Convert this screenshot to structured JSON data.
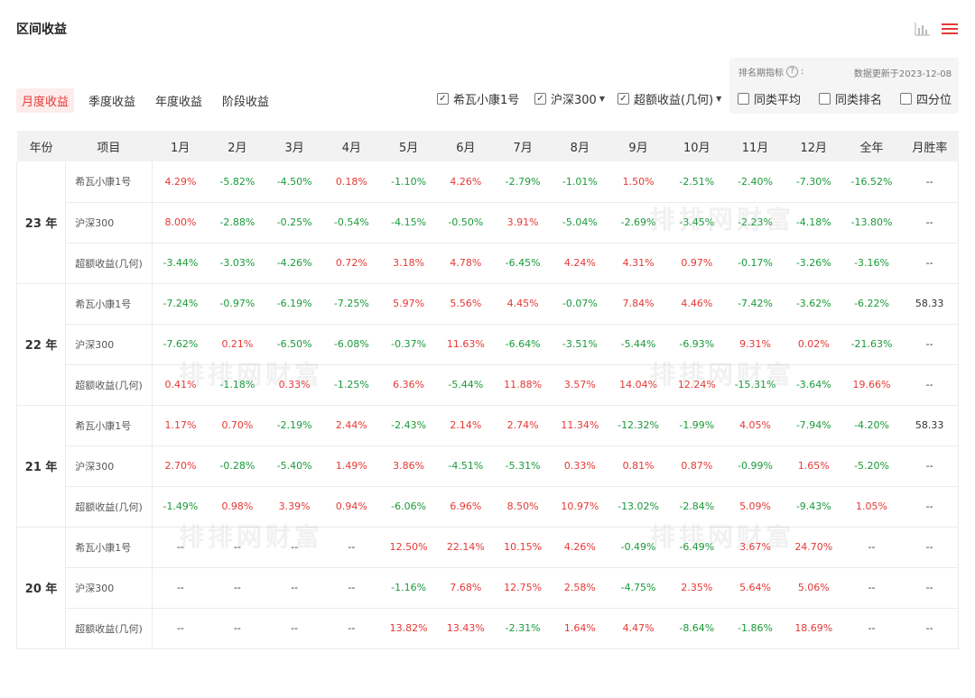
{
  "header": {
    "title": "区间收益"
  },
  "icons": {
    "chart": "bar-chart-icon",
    "menu": "menu-icon"
  },
  "tabs": [
    "月度收益",
    "季度收益",
    "年度收益",
    "阶段收益"
  ],
  "series_options": {
    "fund": "希瓦小康1号",
    "index": "沪深300",
    "excess": "超额收益(几何)"
  },
  "rank_options": {
    "label": "排名期指标",
    "updated": "数据更新于2023-12-08",
    "similar_avg": "同类平均",
    "similar_rank": "同类排名",
    "quartile": "四分位"
  },
  "watermark": "排排网财富",
  "table": {
    "headers": [
      "年份",
      "项目",
      "1月",
      "2月",
      "3月",
      "4月",
      "5月",
      "6月",
      "7月",
      "8月",
      "9月",
      "10月",
      "11月",
      "12月",
      "全年",
      "月胜率"
    ],
    "groups": [
      {
        "year": "23 年",
        "rows": [
          {
            "item": "希瓦小康1号",
            "values": [
              "4.29%",
              "-5.82%",
              "-4.50%",
              "0.18%",
              "-1.10%",
              "4.26%",
              "-2.79%",
              "-1.01%",
              "1.50%",
              "-2.51%",
              "-2.40%",
              "-7.30%",
              "-16.52%",
              "--"
            ]
          },
          {
            "item": "沪深300",
            "values": [
              "8.00%",
              "-2.88%",
              "-0.25%",
              "-0.54%",
              "-4.15%",
              "-0.50%",
              "3.91%",
              "-5.04%",
              "-2.69%",
              "-3.45%",
              "-2.23%",
              "-4.18%",
              "-13.80%",
              "--"
            ]
          },
          {
            "item": "超额收益(几何)",
            "values": [
              "-3.44%",
              "-3.03%",
              "-4.26%",
              "0.72%",
              "3.18%",
              "4.78%",
              "-6.45%",
              "4.24%",
              "4.31%",
              "0.97%",
              "-0.17%",
              "-3.26%",
              "-3.16%",
              "--"
            ]
          }
        ]
      },
      {
        "year": "22 年",
        "rows": [
          {
            "item": "希瓦小康1号",
            "values": [
              "-7.24%",
              "-0.97%",
              "-6.19%",
              "-7.25%",
              "5.97%",
              "5.56%",
              "4.45%",
              "-0.07%",
              "7.84%",
              "4.46%",
              "-7.42%",
              "-3.62%",
              "-6.22%",
              "58.33"
            ]
          },
          {
            "item": "沪深300",
            "values": [
              "-7.62%",
              "0.21%",
              "-6.50%",
              "-6.08%",
              "-0.37%",
              "11.63%",
              "-6.64%",
              "-3.51%",
              "-5.44%",
              "-6.93%",
              "9.31%",
              "0.02%",
              "-21.63%",
              "--"
            ]
          },
          {
            "item": "超额收益(几何)",
            "values": [
              "0.41%",
              "-1.18%",
              "0.33%",
              "-1.25%",
              "6.36%",
              "-5.44%",
              "11.88%",
              "3.57%",
              "14.04%",
              "12.24%",
              "-15.31%",
              "-3.64%",
              "19.66%",
              "--"
            ]
          }
        ]
      },
      {
        "year": "21 年",
        "rows": [
          {
            "item": "希瓦小康1号",
            "values": [
              "1.17%",
              "0.70%",
              "-2.19%",
              "2.44%",
              "-2.43%",
              "2.14%",
              "2.74%",
              "11.34%",
              "-12.32%",
              "-1.99%",
              "4.05%",
              "-7.94%",
              "-4.20%",
              "58.33"
            ]
          },
          {
            "item": "沪深300",
            "values": [
              "2.70%",
              "-0.28%",
              "-5.40%",
              "1.49%",
              "3.86%",
              "-4.51%",
              "-5.31%",
              "0.33%",
              "0.81%",
              "0.87%",
              "-0.99%",
              "1.65%",
              "-5.20%",
              "--"
            ]
          },
          {
            "item": "超额收益(几何)",
            "values": [
              "-1.49%",
              "0.98%",
              "3.39%",
              "0.94%",
              "-6.06%",
              "6.96%",
              "8.50%",
              "10.97%",
              "-13.02%",
              "-2.84%",
              "5.09%",
              "-9.43%",
              "1.05%",
              "--"
            ]
          }
        ]
      },
      {
        "year": "20 年",
        "rows": [
          {
            "item": "希瓦小康1号",
            "values": [
              "--",
              "--",
              "--",
              "--",
              "12.50%",
              "22.14%",
              "10.15%",
              "4.26%",
              "-0.49%",
              "-6.49%",
              "3.67%",
              "24.70%",
              "--",
              "--"
            ]
          },
          {
            "item": "沪深300",
            "values": [
              "--",
              "--",
              "--",
              "--",
              "-1.16%",
              "7.68%",
              "12.75%",
              "2.58%",
              "-4.75%",
              "2.35%",
              "5.64%",
              "5.06%",
              "--",
              "--"
            ]
          },
          {
            "item": "超额收益(几何)",
            "values": [
              "--",
              "--",
              "--",
              "--",
              "13.82%",
              "13.43%",
              "-2.31%",
              "1.64%",
              "4.47%",
              "-8.64%",
              "-1.86%",
              "18.69%",
              "--",
              "--"
            ]
          }
        ]
      }
    ]
  }
}
